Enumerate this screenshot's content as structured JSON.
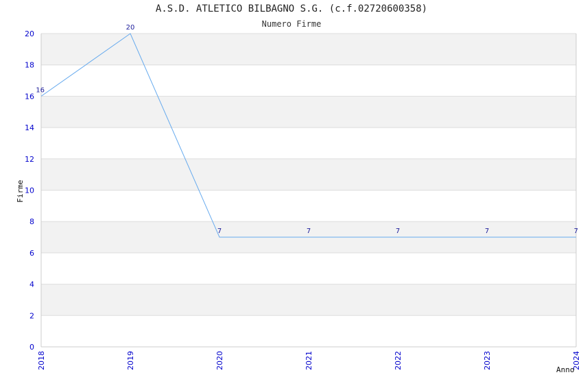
{
  "chart_data": {
    "type": "line",
    "title": "A.S.D. ATLETICO BILBAGNO S.G. (c.f.02720600358)",
    "subtitle": "Numero Firme",
    "xlabel": "Anno",
    "ylabel": "Firme",
    "x": [
      "2018",
      "2019",
      "2020",
      "2021",
      "2022",
      "2023",
      "2024"
    ],
    "values": [
      16,
      20,
      7,
      7,
      7,
      7,
      7
    ],
    "ylim": [
      0,
      20
    ],
    "yticks": [
      0,
      2,
      4,
      6,
      8,
      10,
      12,
      14,
      16,
      18,
      20
    ],
    "grid": true,
    "colors": {
      "line": "#66aaee",
      "band": "#f2f2f2",
      "tick": "#0000cc"
    }
  }
}
